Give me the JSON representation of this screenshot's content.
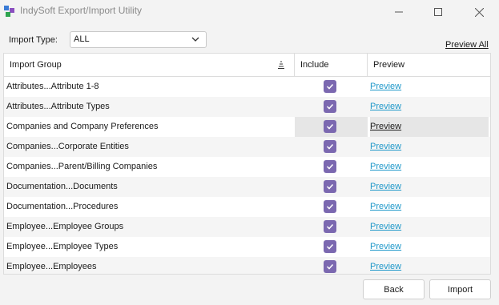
{
  "window": {
    "title": "IndySoft Export/Import Utility",
    "controls": [
      "minimize-icon",
      "maximize-icon",
      "close-icon"
    ]
  },
  "import_type": {
    "label": "Import Type:",
    "selected": "ALL"
  },
  "preview_all_label": "Preview All",
  "grid": {
    "columns": [
      "Import Group",
      "Include",
      "Preview"
    ],
    "rows": [
      {
        "group": "Attributes...Attribute 1-8",
        "include": true,
        "preview": "Preview"
      },
      {
        "group": "Attributes...Attribute Types",
        "include": true,
        "preview": "Preview"
      },
      {
        "group": "Companies and Company Preferences",
        "include": true,
        "preview": "Preview"
      },
      {
        "group": "Companies...Corporate Entities",
        "include": true,
        "preview": "Preview"
      },
      {
        "group": "Companies...Parent/Billing Companies",
        "include": true,
        "preview": "Preview"
      },
      {
        "group": "Documentation...Documents",
        "include": true,
        "preview": "Preview"
      },
      {
        "group": "Documentation...Procedures",
        "include": true,
        "preview": "Preview"
      },
      {
        "group": "Employee...Employee Groups",
        "include": true,
        "preview": "Preview"
      },
      {
        "group": "Employee...Employee Types",
        "include": true,
        "preview": "Preview"
      },
      {
        "group": "Employee...Employees",
        "include": true,
        "preview": "Preview"
      }
    ]
  },
  "buttons": {
    "back": "Back",
    "import": "Import"
  },
  "colors": {
    "checkbox": "#7b68b0",
    "link": "#1d97c9",
    "selected_row": "#e6e6e6"
  }
}
